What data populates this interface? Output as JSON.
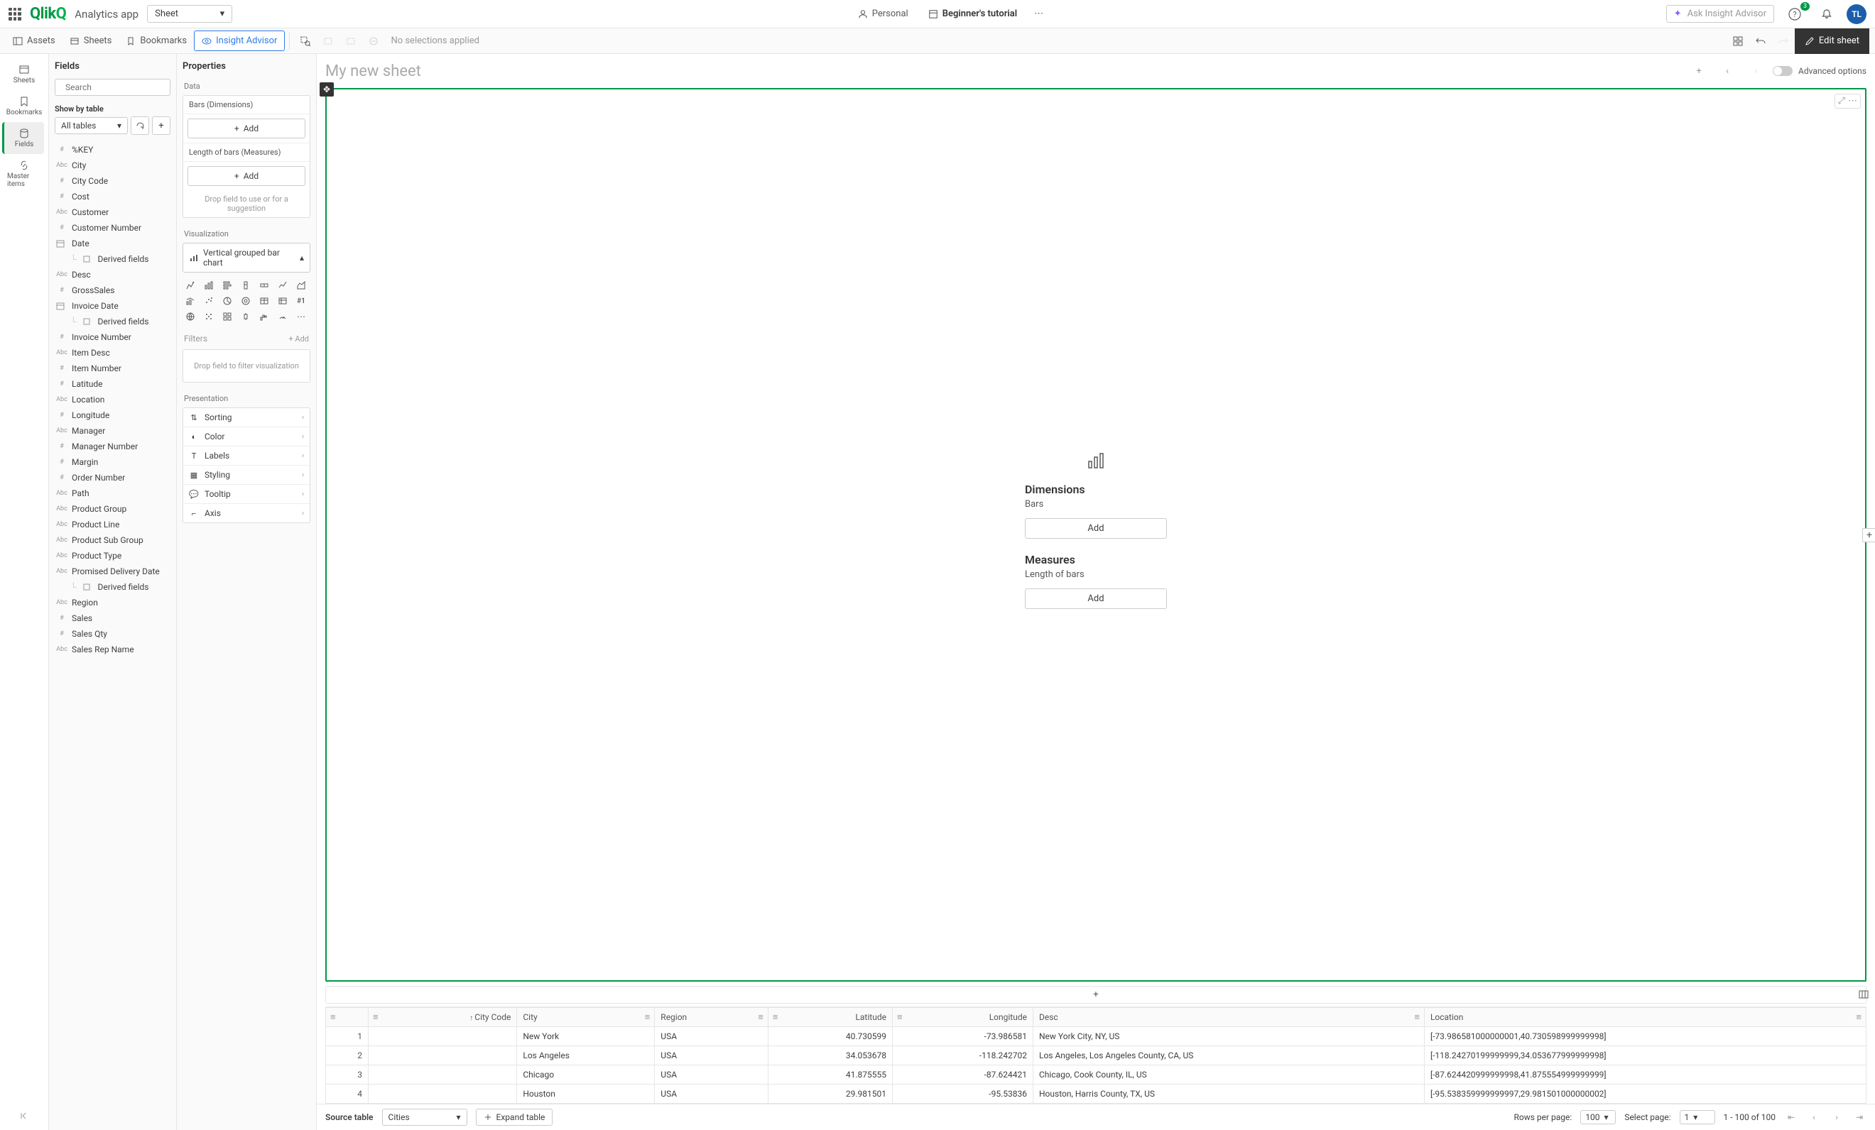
{
  "header": {
    "app_name": "Analytics app",
    "sheet_dropdown": "Sheet",
    "personal": "Personal",
    "tutorial": "Beginner's tutorial",
    "insight_placeholder": "Ask Insight Advisor",
    "badge_count": "3",
    "avatar_initials": "TL"
  },
  "toolbar": {
    "assets": "Assets",
    "sheets": "Sheets",
    "bookmarks": "Bookmarks",
    "insight": "Insight Advisor",
    "no_selections": "No selections applied",
    "edit_sheet": "Edit sheet"
  },
  "rail": {
    "sheets": "Sheets",
    "bookmarks": "Bookmarks",
    "fields": "Fields",
    "master": "Master items"
  },
  "fields": {
    "title": "Fields",
    "search_placeholder": "Search",
    "show_by": "Show by table",
    "all_tables": "All tables",
    "list": [
      {
        "type": "#",
        "name": "%KEY"
      },
      {
        "type": "Abc",
        "name": "City"
      },
      {
        "type": "#",
        "name": "City Code"
      },
      {
        "type": "#",
        "name": "Cost"
      },
      {
        "type": "Abc",
        "name": "Customer"
      },
      {
        "type": "#",
        "name": "Customer Number"
      },
      {
        "type": "date",
        "name": "Date"
      },
      {
        "type": "child",
        "name": "Derived fields"
      },
      {
        "type": "Abc",
        "name": "Desc"
      },
      {
        "type": "#",
        "name": "GrossSales"
      },
      {
        "type": "date",
        "name": "Invoice Date"
      },
      {
        "type": "child",
        "name": "Derived fields"
      },
      {
        "type": "#",
        "name": "Invoice Number"
      },
      {
        "type": "Abc",
        "name": "Item Desc"
      },
      {
        "type": "#",
        "name": "Item Number"
      },
      {
        "type": "#",
        "name": "Latitude"
      },
      {
        "type": "Abc",
        "name": "Location"
      },
      {
        "type": "#",
        "name": "Longitude"
      },
      {
        "type": "Abc",
        "name": "Manager"
      },
      {
        "type": "#",
        "name": "Manager Number"
      },
      {
        "type": "#",
        "name": "Margin"
      },
      {
        "type": "#",
        "name": "Order Number"
      },
      {
        "type": "Abc",
        "name": "Path"
      },
      {
        "type": "Abc",
        "name": "Product Group"
      },
      {
        "type": "Abc",
        "name": "Product Line"
      },
      {
        "type": "Abc",
        "name": "Product Sub Group"
      },
      {
        "type": "Abc",
        "name": "Product Type"
      },
      {
        "type": "Abc",
        "name": "Promised Delivery Date"
      },
      {
        "type": "child",
        "name": "Derived fields"
      },
      {
        "type": "Abc",
        "name": "Region"
      },
      {
        "type": "#",
        "name": "Sales"
      },
      {
        "type": "#",
        "name": "Sales Qty"
      },
      {
        "type": "Abc",
        "name": "Sales Rep Name"
      }
    ]
  },
  "props": {
    "title": "Properties",
    "data": "Data",
    "bars_dims": "Bars (Dimensions)",
    "length_measures": "Length of bars (Measures)",
    "add": "Add",
    "drop_hint": "Drop field to use or for a suggestion",
    "visualization": "Visualization",
    "viz_type": "Vertical grouped bar chart",
    "filters": "Filters",
    "filters_add": "+ Add",
    "filter_drop": "Drop field to filter visualization",
    "presentation": "Presentation",
    "pres_items": [
      "Sorting",
      "Color",
      "Labels",
      "Styling",
      "Tooltip",
      "Axis"
    ]
  },
  "canvas": {
    "sheet_title": "My new sheet",
    "advanced": "Advanced options",
    "dimensions": "Dimensions",
    "bars": "Bars",
    "measures": "Measures",
    "length": "Length of bars",
    "add": "Add"
  },
  "table": {
    "columns": [
      "City Code",
      "City",
      "Region",
      "Latitude",
      "Longitude",
      "Desc",
      "Location"
    ],
    "rows": [
      {
        "n": "1",
        "code": "",
        "city": "New York",
        "region": "USA",
        "lat": "40.730599",
        "lon": "-73.986581",
        "desc": "New York City, NY, US",
        "loc": "[-73.986581000000001,40.730598999999998]"
      },
      {
        "n": "2",
        "code": "",
        "city": "Los Angeles",
        "region": "USA",
        "lat": "34.053678",
        "lon": "-118.242702",
        "desc": "Los Angeles, Los Angeles County, CA, US",
        "loc": "[-118.24270199999999,34.053677999999998]"
      },
      {
        "n": "3",
        "code": "",
        "city": "Chicago",
        "region": "USA",
        "lat": "41.875555",
        "lon": "-87.624421",
        "desc": "Chicago, Cook County, IL, US",
        "loc": "[-87.624420999999998,41.875554999999999]"
      },
      {
        "n": "4",
        "code": "",
        "city": "Houston",
        "region": "USA",
        "lat": "29.981501",
        "lon": "-95.53836",
        "desc": "Houston, Harris County, TX, US",
        "loc": "[-95.538359999999997,29.981501000000002]"
      }
    ],
    "source_label": "Source table",
    "source_value": "Cities",
    "expand": "Expand table",
    "rows_per_page_label": "Rows per page:",
    "rows_per_page": "100",
    "select_page_label": "Select page:",
    "select_page": "1",
    "range": "1 - 100 of 100"
  }
}
